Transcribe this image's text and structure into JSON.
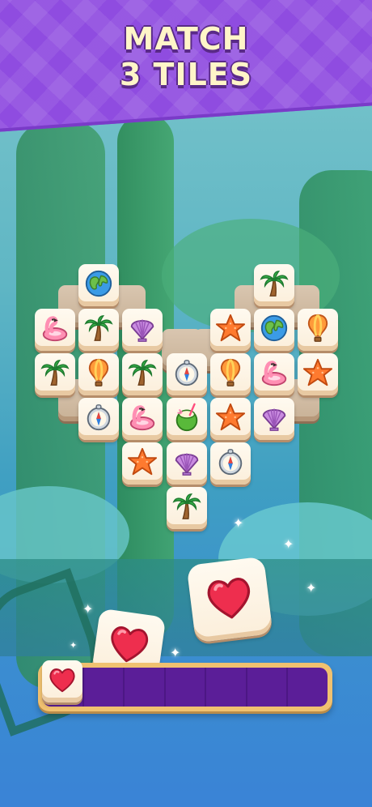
{
  "header": {
    "title_line1": "MATCH",
    "title_line2": "3 TILES"
  },
  "board": {
    "tiles": [
      {
        "icon": "earth-icon",
        "layer": "top"
      },
      {
        "icon": "palm-icon",
        "layer": "top"
      },
      {
        "icon": "flamingo-icon",
        "layer": "top"
      },
      {
        "icon": "palm-icon",
        "layer": "top"
      },
      {
        "icon": "shell-icon",
        "layer": "top"
      },
      {
        "icon": "starfish-icon",
        "layer": "top"
      },
      {
        "icon": "earth-icon",
        "layer": "top"
      },
      {
        "icon": "balloon-icon",
        "layer": "top"
      },
      {
        "icon": "palm-icon",
        "layer": "top"
      },
      {
        "icon": "balloon-icon",
        "layer": "top"
      },
      {
        "icon": "palm-icon",
        "layer": "top"
      },
      {
        "icon": "compass-icon",
        "layer": "top"
      },
      {
        "icon": "balloon-icon",
        "layer": "top"
      },
      {
        "icon": "flamingo-icon",
        "layer": "top"
      },
      {
        "icon": "starfish-icon",
        "layer": "top"
      },
      {
        "icon": "compass-icon",
        "layer": "top"
      },
      {
        "icon": "flamingo-icon",
        "layer": "top"
      },
      {
        "icon": "coconut-icon",
        "layer": "top"
      },
      {
        "icon": "starfish-icon",
        "layer": "top"
      },
      {
        "icon": "shell-icon",
        "layer": "top"
      },
      {
        "icon": "starfish-icon",
        "layer": "top"
      },
      {
        "icon": "shell-icon",
        "layer": "top"
      },
      {
        "icon": "compass-icon",
        "layer": "top"
      },
      {
        "icon": "palm-icon",
        "layer": "top"
      }
    ]
  },
  "flying_tiles": [
    {
      "icon": "heart-icon",
      "size": "large"
    },
    {
      "icon": "heart-icon",
      "size": "medium"
    }
  ],
  "tray": {
    "slot_count": 7,
    "filled": [
      {
        "icon": "heart-icon"
      }
    ]
  },
  "colors": {
    "banner": "#8f4ce0",
    "title": "#fff5c8",
    "tray_frame": "#f0c170",
    "tray_inner": "#5b1e98"
  }
}
